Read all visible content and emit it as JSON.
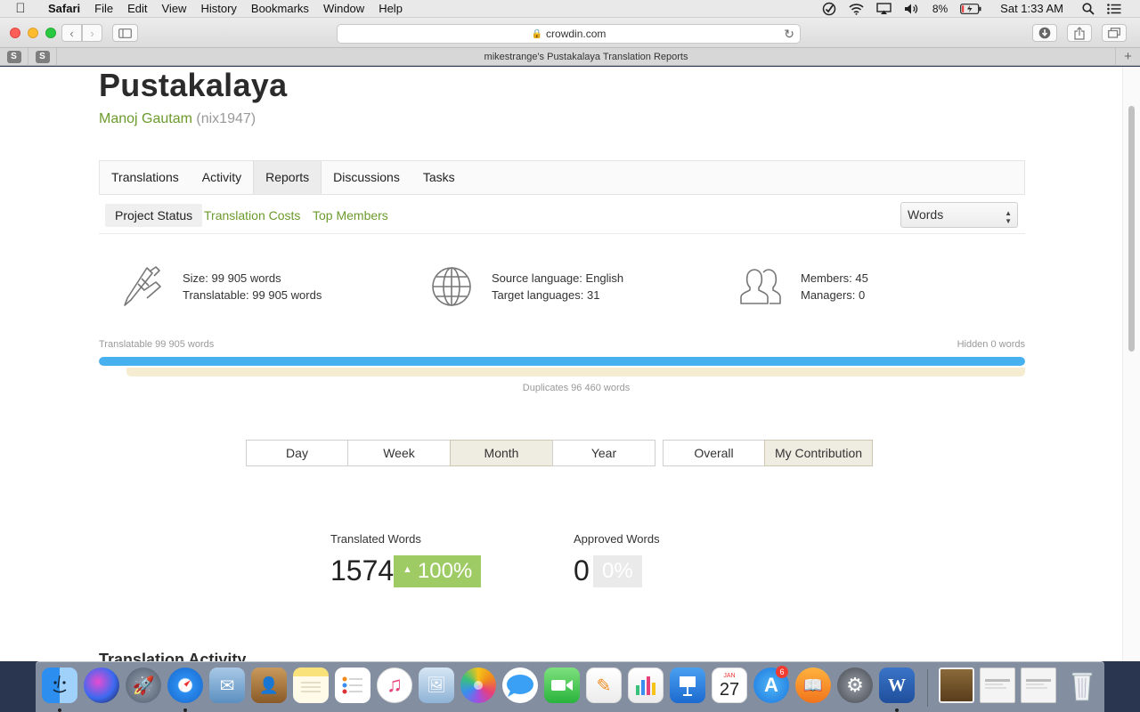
{
  "menubar": {
    "app": "Safari",
    "items": [
      "File",
      "Edit",
      "View",
      "History",
      "Bookmarks",
      "Window",
      "Help"
    ],
    "battery": "8%",
    "clock": "Sat 1:33 AM"
  },
  "browser": {
    "url": "crowdin.com",
    "pinned_tabs": [
      "S",
      "S"
    ],
    "tab_title": "mikestrange's Pustakalaya Translation Reports"
  },
  "project": {
    "title": "Pustakalaya",
    "owner_name": "Manoj Gautam",
    "owner_handle": "(nix1947)"
  },
  "main_tabs": [
    {
      "label": "Translations"
    },
    {
      "label": "Activity"
    },
    {
      "label": "Reports",
      "active": true
    },
    {
      "label": "Discussions"
    },
    {
      "label": "Tasks"
    }
  ],
  "sub_tabs": [
    {
      "label": "Project Status",
      "active": true
    },
    {
      "label": "Translation Costs"
    },
    {
      "label": "Top Members"
    }
  ],
  "unit_select": {
    "value": "Words"
  },
  "stats": {
    "size": "Size: 99 905 words",
    "translatable": "Translatable: 99 905 words",
    "source_language": "Source language: English",
    "target_languages": "Target languages: 31",
    "members": "Members: 45",
    "managers": "Managers: 0"
  },
  "progress": {
    "translatable_label": "Translatable 99 905 words",
    "hidden_label": "Hidden 0 words",
    "duplicates_label": "Duplicates 96 460 words",
    "translatable_fraction": 1.0,
    "duplicates_fraction": 0.97
  },
  "period_buttons": [
    {
      "label": "Day"
    },
    {
      "label": "Week"
    },
    {
      "label": "Month",
      "active": true
    },
    {
      "label": "Year"
    }
  ],
  "scope_buttons": [
    {
      "label": "Overall"
    },
    {
      "label": "My Contribution",
      "active": true
    }
  ],
  "metrics": {
    "translated_label": "Translated Words",
    "translated_value": "1574",
    "translated_change": "100%",
    "approved_label": "Approved Words",
    "approved_value": "0",
    "approved_change": "0%"
  },
  "section": {
    "title": "Translation Activity"
  },
  "colors": {
    "brand_green": "#6c9a2d",
    "progress_blue": "#46b1ee",
    "duplicates_bar": "#f6ecd1",
    "badge_green": "#9ecb64"
  },
  "dock": {
    "apps": [
      "finder-icon",
      "siri-icon",
      "launchpad-icon",
      "safari-icon",
      "mail-icon",
      "contacts-icon",
      "notes-icon",
      "reminders-icon",
      "itunes-icon",
      "preview-icon",
      "photos-icon",
      "messages-icon",
      "facetime-icon",
      "pages-icon",
      "numbers-icon",
      "keynote-icon",
      "calendar-icon",
      "app-store-icon",
      "ibooks-icon",
      "system-preferences-icon",
      "word-icon",
      "photo-stack-icon",
      "screenshot-icon",
      "screenshot-icon",
      "trash-icon"
    ],
    "calendar_day": "27",
    "calendar_month": "JAN",
    "app_store_badge": "6"
  }
}
